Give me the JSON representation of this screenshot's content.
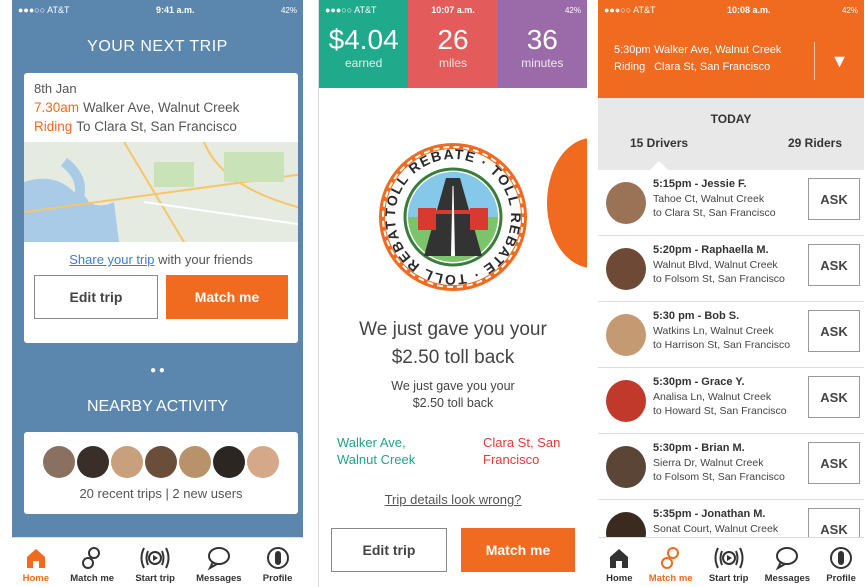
{
  "screen1": {
    "status": {
      "carrier": "●●●○○ AT&T",
      "time": "9:41 a.m.",
      "battery": "42%"
    },
    "title": "YOUR NEXT TRIP",
    "trip": {
      "date": "8th Jan",
      "time": "7.30am",
      "from": "Walker Ave, Walnut Creek",
      "mode": "Riding",
      "to": "To Clara St, San Francisco"
    },
    "share_link": "Share your trip",
    "share_rest": " with your friends",
    "edit_label": "Edit trip",
    "match_label": "Match me",
    "dots": "● ●",
    "nearby_title": "NEARBY ACTIVITY",
    "nearby_stats": "20 recent trips | 2 new users",
    "avatar_colors": [
      "#8a7060",
      "#3a2e28",
      "#c9a07c",
      "#6b4e3a",
      "#b8926a",
      "#2c2622",
      "#d4a889"
    ]
  },
  "screen2": {
    "status": {
      "carrier": "●●●○○ AT&T",
      "time": "10:07 a.m.",
      "battery": "42%"
    },
    "stats": [
      {
        "value": "$4.04",
        "label": "earned",
        "color": "#1faa8c"
      },
      {
        "value": "26",
        "label": "miles",
        "color": "#e35b5b"
      },
      {
        "value": "36",
        "label": "minutes",
        "color": "#9b6aa8"
      }
    ],
    "badge_text": "TOLL REBATE · TOLL REBATE · TOLL REBATE ·",
    "message": "We just gave you your $2.50 toll back",
    "sub_message": "We just gave you your $2.50 toll back",
    "from": "Walker Ave, Walnut Creek",
    "to": "Clara St, San Francisco",
    "wrong_link": "Trip details look wrong?",
    "edit_label": "Edit trip",
    "match_label": "Match me"
  },
  "screen3": {
    "status": {
      "carrier": "●●●○○ AT&T",
      "time": "10:08 a.m.",
      "battery": "42%"
    },
    "trip_time": "5:30pm",
    "trip_from": "Walker Ave, Walnut Creek",
    "trip_mode": "Riding",
    "trip_to": "Clara St, San Francisco",
    "chevron": "▼",
    "today": "TODAY",
    "drivers_tab": "15 Drivers",
    "riders_tab": "29 Riders",
    "ask_label": "ASK",
    "drivers": [
      {
        "name": "5:15pm - Jessie F.",
        "from": "Tahoe Ct, Walnut Creek",
        "to": "to Clara St, San Francisco",
        "color": "#9a7256"
      },
      {
        "name": "5:20pm - Raphaella M.",
        "from": "Walnut Blvd, Walnut Creek",
        "to": "to Folsom St, San Francisco",
        "color": "#6e4a36"
      },
      {
        "name": "5:30 pm - Bob S.",
        "from": "Watkins Ln, Walnut Creek",
        "to": "to Harrison St, San Francisco",
        "color": "#c49a72"
      },
      {
        "name": "5:30pm - Grace Y.",
        "from": "Analisa Ln, Walnut Creek",
        "to": "to Howard St, San Francisco",
        "color": "#c0392b"
      },
      {
        "name": "5:30pm - Brian M.",
        "from": "Sierra Dr, Walnut Creek",
        "to": "to Folsom St, San Francisco",
        "color": "#5b4536"
      },
      {
        "name": "5:35pm - Jonathan M.",
        "from": "Sonat Court, Walnut Creek",
        "to": "",
        "color": "#3a2a20"
      }
    ]
  },
  "tabs": {
    "home": "Home",
    "match": "Match me",
    "start": "Start trip",
    "messages": "Messages",
    "profile": "Profile"
  }
}
